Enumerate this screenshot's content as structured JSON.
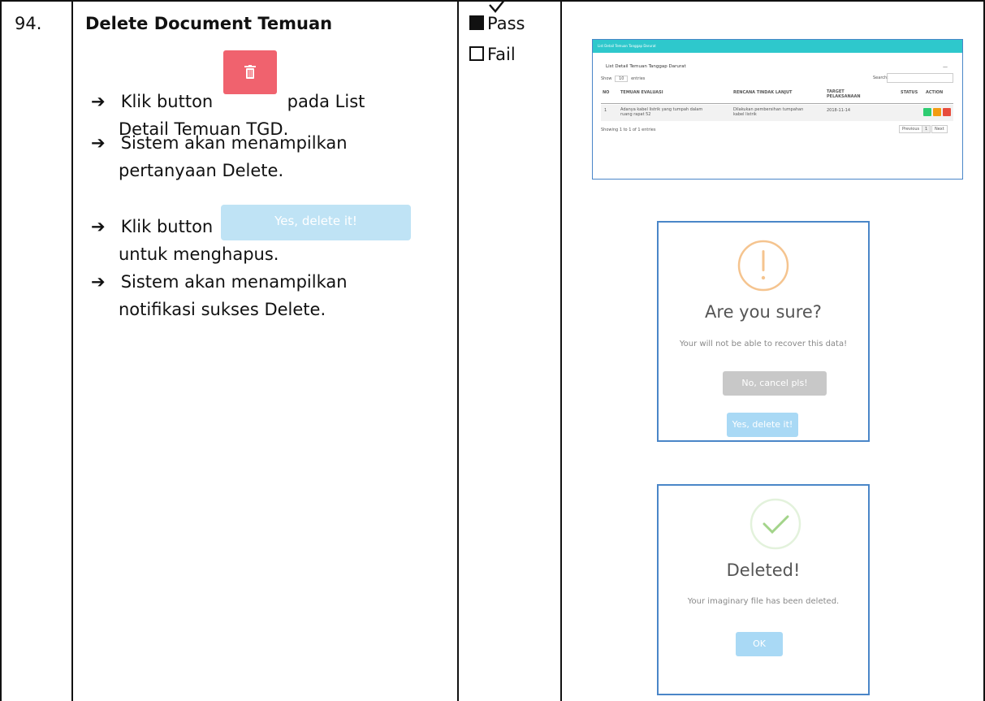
{
  "row": {
    "number": "94.",
    "title": "Delete Document Temuan",
    "steps": [
      {
        "pre": "Klik button",
        "post": "pada List",
        "cont": "Detail Temuan TGD."
      },
      {
        "pre": "Sistem akan menampilkan",
        "cont": "pertanyaan Delete."
      },
      {
        "pre": "Klik button",
        "cont": "untuk menghapus."
      },
      {
        "pre": "Sistem akan menampilkan",
        "cont": "notifikasi sukses Delete."
      }
    ],
    "inline_yes_label": "Yes, delete it!",
    "status": {
      "pass": "Pass",
      "fail": "Fail",
      "pass_checked": true
    }
  },
  "screenshot_list": {
    "header": "List Detail Temuan Tanggap Darurat",
    "panel_title": "List Detail Temuan Tanggap Darurat",
    "show_label": "Show",
    "entries_value": "10",
    "entries_label": "entries",
    "search_label": "Search:",
    "columns": [
      "NO",
      "TEMUAN EVALUASI",
      "RENCANA TINDAK LANJUT",
      "TARGET PELAKSANAAN",
      "STATUS",
      "ACTION"
    ],
    "rows": [
      [
        "1",
        "Adanya kabel listrik yang tumpah dalam ruang rapat 52",
        "Dilakukan pembersihan tumpahan kabel listrik",
        "2018-11-14",
        ""
      ]
    ],
    "footer": "Showing 1 to 1 of 1 entries",
    "pagination": [
      "Previous",
      "1",
      "Next"
    ],
    "colors": {
      "header": "#2ec8cc",
      "view": "#2ecc71",
      "edit": "#f39c12",
      "delete": "#e74c3c"
    }
  },
  "dialog_confirm": {
    "title": "Are you sure?",
    "text": "Your will not be able to recover this data!",
    "cancel_label": "No, cancel pls!",
    "confirm_label": "Yes, delete it!"
  },
  "dialog_success": {
    "title": "Deleted!",
    "text": "Your imaginary file has been deleted.",
    "ok_label": "OK"
  }
}
